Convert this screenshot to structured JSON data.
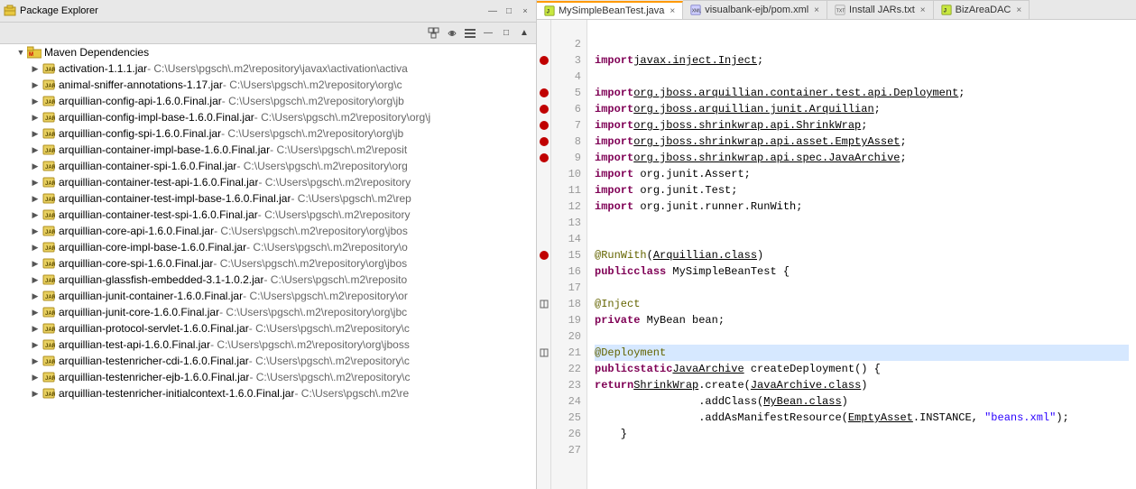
{
  "packageExplorer": {
    "title": "Package Explorer",
    "closeLabel": "×",
    "toolbar": {
      "buttons": [
        "⊞",
        "▦",
        "≡",
        "—",
        "□"
      ]
    },
    "tree": {
      "root": {
        "label": "Maven Dependencies",
        "expanded": true
      },
      "items": [
        {
          "name": "activation-1.1.1.jar",
          "path": " - C:\\Users\\pgsch\\.m2\\repository\\javax\\activation\\activa"
        },
        {
          "name": "animal-sniffer-annotations-1.17.jar",
          "path": " - C:\\Users\\pgsch\\.m2\\repository\\org\\c"
        },
        {
          "name": "arquillian-config-api-1.6.0.Final.jar",
          "path": " - C:\\Users\\pgsch\\.m2\\repository\\org\\jb"
        },
        {
          "name": "arquillian-config-impl-base-1.6.0.Final.jar",
          "path": " - C:\\Users\\pgsch\\.m2\\repository\\org\\j"
        },
        {
          "name": "arquillian-config-spi-1.6.0.Final.jar",
          "path": " - C:\\Users\\pgsch\\.m2\\repository\\org\\jb"
        },
        {
          "name": "arquillian-container-impl-base-1.6.0.Final.jar",
          "path": " - C:\\Users\\pgsch\\.m2\\reposit"
        },
        {
          "name": "arquillian-container-spi-1.6.0.Final.jar",
          "path": " - C:\\Users\\pgsch\\.m2\\repository\\org"
        },
        {
          "name": "arquillian-container-test-api-1.6.0.Final.jar",
          "path": " - C:\\Users\\pgsch\\.m2\\repository"
        },
        {
          "name": "arquillian-container-test-impl-base-1.6.0.Final.jar",
          "path": " - C:\\Users\\pgsch\\.m2\\rep"
        },
        {
          "name": "arquillian-container-test-spi-1.6.0.Final.jar",
          "path": " - C:\\Users\\pgsch\\.m2\\repository"
        },
        {
          "name": "arquillian-core-api-1.6.0.Final.jar",
          "path": " - C:\\Users\\pgsch\\.m2\\repository\\org\\jbos"
        },
        {
          "name": "arquillian-core-impl-base-1.6.0.Final.jar",
          "path": " - C:\\Users\\pgsch\\.m2\\repository\\o"
        },
        {
          "name": "arquillian-core-spi-1.6.0.Final.jar",
          "path": " - C:\\Users\\pgsch\\.m2\\repository\\org\\jbos"
        },
        {
          "name": "arquillian-glassfish-embedded-3.1-1.0.2.jar",
          "path": " - C:\\Users\\pgsch\\.m2\\reposito"
        },
        {
          "name": "arquillian-junit-container-1.6.0.Final.jar",
          "path": " - C:\\Users\\pgsch\\.m2\\repository\\or"
        },
        {
          "name": "arquillian-junit-core-1.6.0.Final.jar",
          "path": " - C:\\Users\\pgsch\\.m2\\repository\\org\\jbc"
        },
        {
          "name": "arquillian-protocol-servlet-1.6.0.Final.jar",
          "path": " - C:\\Users\\pgsch\\.m2\\repository\\c"
        },
        {
          "name": "arquillian-test-api-1.6.0.Final.jar",
          "path": " - C:\\Users\\pgsch\\.m2\\repository\\org\\jboss"
        },
        {
          "name": "arquillian-testenricher-cdi-1.6.0.Final.jar",
          "path": " - C:\\Users\\pgsch\\.m2\\repository\\c"
        },
        {
          "name": "arquillian-testenricher-ejb-1.6.0.Final.jar",
          "path": " - C:\\Users\\pgsch\\.m2\\repository\\c"
        },
        {
          "name": "arquillian-testenricher-initialcontext-1.6.0.Final.jar",
          "path": " - C:\\Users\\pgsch\\.m2\\re"
        }
      ]
    }
  },
  "editor": {
    "tabs": [
      {
        "id": "tab-java",
        "label": "MySimpleBeanTest.java",
        "type": "java",
        "active": true
      },
      {
        "id": "tab-xml",
        "label": "visualbank-ejb/pom.xml",
        "type": "xml",
        "active": false
      },
      {
        "id": "tab-txt",
        "label": "Install JARs.txt",
        "type": "txt",
        "active": false
      },
      {
        "id": "tab-biz",
        "label": "BizAreaDAC",
        "type": "java",
        "active": false
      }
    ],
    "lines": [
      {
        "num": "",
        "content": ""
      },
      {
        "num": "2",
        "content": ""
      },
      {
        "num": "3",
        "content": "import javax.inject.Inject;",
        "hasIcon": true,
        "iconType": "error"
      },
      {
        "num": "4",
        "content": ""
      },
      {
        "num": "5",
        "content": "import org.jboss.arquillian.container.test.api.Deployment;",
        "hasIcon": true,
        "iconType": "error"
      },
      {
        "num": "6",
        "content": "import org.jboss.arquillian.junit.Arquillian;",
        "hasIcon": true,
        "iconType": "error"
      },
      {
        "num": "7",
        "content": "import org.jboss.shrinkwrap.api.ShrinkWrap;",
        "hasIcon": true,
        "iconType": "error"
      },
      {
        "num": "8",
        "content": "import org.jboss.shrinkwrap.api.asset.EmptyAsset;",
        "hasIcon": true,
        "iconType": "error"
      },
      {
        "num": "9",
        "content": "import org.jboss.shrinkwrap.api.spec.JavaArchive;",
        "hasIcon": true,
        "iconType": "error"
      },
      {
        "num": "10",
        "content": "import org.junit.Assert;"
      },
      {
        "num": "11",
        "content": "import org.junit.Test;"
      },
      {
        "num": "12",
        "content": "import org.junit.runner.RunWith;"
      },
      {
        "num": "13",
        "content": ""
      },
      {
        "num": "14",
        "content": ""
      },
      {
        "num": "15",
        "content": "@RunWith(Arquillian.class)",
        "hasIcon": true,
        "iconType": "error"
      },
      {
        "num": "16",
        "content": "public class MySimpleBeanTest {"
      },
      {
        "num": "17",
        "content": ""
      },
      {
        "num": "18",
        "content": "    @Inject",
        "hasIcon": true,
        "iconType": "expand"
      },
      {
        "num": "19",
        "content": "    private MyBean bean;"
      },
      {
        "num": "20",
        "content": ""
      },
      {
        "num": "21",
        "content": "    @Deployment",
        "hasIcon": true,
        "iconType": "expand",
        "highlighted": true
      },
      {
        "num": "22",
        "content": "    public static JavaArchive createDeployment() {"
      },
      {
        "num": "23",
        "content": "        return ShrinkWrap.create(JavaArchive.class)"
      },
      {
        "num": "24",
        "content": "                .addClass(MyBean.class)"
      },
      {
        "num": "25",
        "content": "                .addAsManifestResource(EmptyAsset.INSTANCE, \"beans.xml\");"
      },
      {
        "num": "26",
        "content": "    }"
      },
      {
        "num": "27",
        "content": ""
      }
    ]
  }
}
